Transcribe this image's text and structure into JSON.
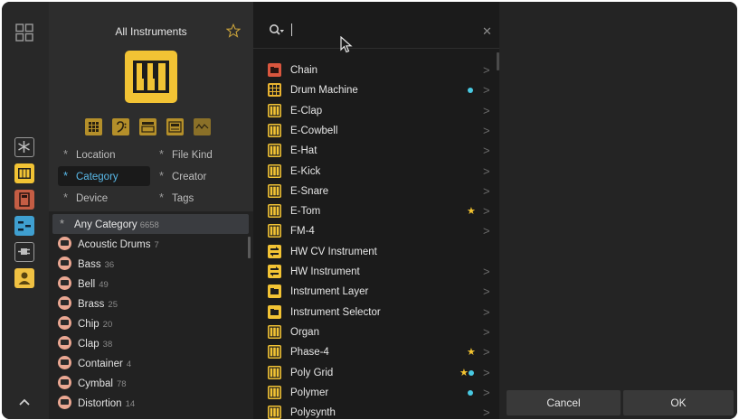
{
  "filters": {
    "title": "All Instruments",
    "facets": [
      {
        "label": "Location",
        "active": false
      },
      {
        "label": "File Kind",
        "active": false
      },
      {
        "label": "Category",
        "active": true
      },
      {
        "label": "Creator",
        "active": false
      },
      {
        "label": "Device",
        "active": false
      },
      {
        "label": "Tags",
        "active": false
      }
    ],
    "type_icons": [
      "drum-grid-icon",
      "bass-clef-icon",
      "keyboard-icon",
      "synth-icon",
      "waveform-icon"
    ]
  },
  "categories": {
    "any": {
      "label": "Any Category",
      "count": "6658"
    },
    "items": [
      {
        "label": "Acoustic Drums",
        "count": "7"
      },
      {
        "label": "Bass",
        "count": "36"
      },
      {
        "label": "Bell",
        "count": "49"
      },
      {
        "label": "Brass",
        "count": "25"
      },
      {
        "label": "Chip",
        "count": "20"
      },
      {
        "label": "Clap",
        "count": "38"
      },
      {
        "label": "Container",
        "count": "4"
      },
      {
        "label": "Cymbal",
        "count": "78"
      },
      {
        "label": "Distortion",
        "count": "14"
      }
    ]
  },
  "search": {
    "placeholder": "",
    "value": ""
  },
  "results": [
    {
      "label": "Chain",
      "icon": "chain-icon",
      "color": "#d9563e",
      "chevron": true,
      "dot": false,
      "star": false
    },
    {
      "label": "Drum Machine",
      "icon": "drum-machine-icon",
      "color": "#e9b330",
      "chevron": true,
      "dot": true,
      "star": false
    },
    {
      "label": "E-Clap",
      "icon": "piano-icon",
      "color": "#f2c334",
      "chevron": true,
      "dot": false,
      "star": false
    },
    {
      "label": "E-Cowbell",
      "icon": "piano-icon",
      "color": "#f2c334",
      "chevron": true,
      "dot": false,
      "star": false
    },
    {
      "label": "E-Hat",
      "icon": "piano-icon",
      "color": "#f2c334",
      "chevron": true,
      "dot": false,
      "star": false
    },
    {
      "label": "E-Kick",
      "icon": "piano-icon",
      "color": "#f2c334",
      "chevron": true,
      "dot": false,
      "star": false
    },
    {
      "label": "E-Snare",
      "icon": "piano-icon",
      "color": "#f2c334",
      "chevron": true,
      "dot": false,
      "star": false
    },
    {
      "label": "E-Tom",
      "icon": "piano-icon",
      "color": "#f2c334",
      "chevron": true,
      "dot": false,
      "star": true
    },
    {
      "label": "FM-4",
      "icon": "piano-icon",
      "color": "#f2c334",
      "chevron": true,
      "dot": false,
      "star": false
    },
    {
      "label": "HW CV Instrument",
      "icon": "hardware-icon",
      "color": "#f2c334",
      "chevron": false,
      "dot": false,
      "star": false
    },
    {
      "label": "HW Instrument",
      "icon": "hardware-icon",
      "color": "#f2c334",
      "chevron": true,
      "dot": false,
      "star": false
    },
    {
      "label": "Instrument Layer",
      "icon": "layer-icon",
      "color": "#f2c334",
      "chevron": true,
      "dot": false,
      "star": false
    },
    {
      "label": "Instrument Selector",
      "icon": "layer-icon",
      "color": "#f2c334",
      "chevron": true,
      "dot": false,
      "star": false
    },
    {
      "label": "Organ",
      "icon": "piano-icon",
      "color": "#f2c334",
      "chevron": true,
      "dot": false,
      "star": false
    },
    {
      "label": "Phase-4",
      "icon": "piano-icon",
      "color": "#f2c334",
      "chevron": true,
      "dot": false,
      "star": true
    },
    {
      "label": "Poly Grid",
      "icon": "piano-icon",
      "color": "#f2c334",
      "chevron": true,
      "dot": true,
      "star": true
    },
    {
      "label": "Polymer",
      "icon": "piano-icon",
      "color": "#f2c334",
      "chevron": true,
      "dot": true,
      "star": false
    },
    {
      "label": "Polysynth",
      "icon": "piano-icon",
      "color": "#f2c334",
      "chevron": true,
      "dot": false,
      "star": false
    }
  ],
  "buttons": {
    "cancel": "Cancel",
    "ok": "OK"
  },
  "colors": {
    "accent": "#59b9e9",
    "instrument": "#f2c334",
    "dot": "#48c9e2",
    "star": "#f4c430"
  }
}
